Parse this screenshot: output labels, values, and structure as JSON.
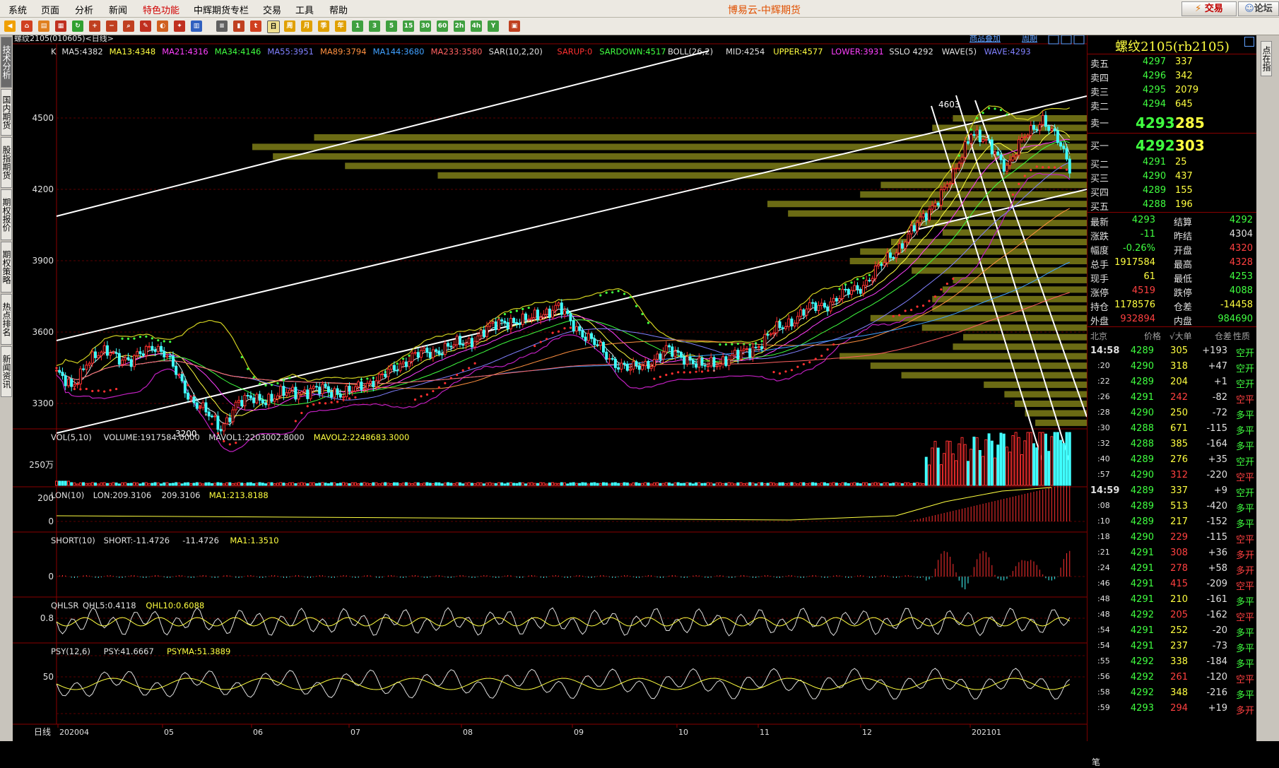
{
  "menu": {
    "items": [
      "系统",
      "页面",
      "分析",
      "新闻",
      "特色功能",
      "中辉期货专栏",
      "交易",
      "工具",
      "帮助"
    ],
    "app_title": "博易云-中辉期货",
    "trade_button": "交易",
    "forum_button": "论坛"
  },
  "left_tabs": [
    "技术分析",
    "国内期货",
    "股指期货",
    "期权报价",
    "期权策略",
    "热点排名",
    "新闻资讯"
  ],
  "right_tabs": "点在指",
  "chart": {
    "instrument_label": "螺纹2105(010605)<日线>",
    "overlay_link": "商品叠加",
    "period_link": "周期",
    "period_label": "日线",
    "main_indicators": [
      {
        "text": "K",
        "color": "#e0e0e0"
      },
      {
        "text": "MA5:4382",
        "color": "#e0e0e0"
      },
      {
        "text": "MA13:4348",
        "color": "#ffff40"
      },
      {
        "text": "MA21:4316",
        "color": "#ff40ff"
      },
      {
        "text": "MA34:4146",
        "color": "#40ff40"
      },
      {
        "text": "MA55:3951",
        "color": "#8080ff"
      },
      {
        "text": "MA89:3794",
        "color": "#ff9040"
      },
      {
        "text": "MA144:3680",
        "color": "#40a0ff"
      },
      {
        "text": "MA233:3580",
        "color": "#ff6060"
      },
      {
        "text": "SAR(10,2,20)",
        "color": "#e0e0e0"
      },
      {
        "text": "SARUP:0",
        "color": "#ff3030"
      },
      {
        "text": "SARDOWN:4517",
        "color": "#40ff40"
      },
      {
        "text": "BOLL(26,2)",
        "color": "#e0e0e0"
      },
      {
        "text": "MID:4254",
        "color": "#e0e0e0"
      },
      {
        "text": "UPPER:4577",
        "color": "#ffff40"
      },
      {
        "text": "LOWER:3931",
        "color": "#ff40ff"
      },
      {
        "text": "SSLO 4292",
        "color": "#e0e0e0"
      },
      {
        "text": "WAVE(5)",
        "color": "#e0e0e0"
      },
      {
        "text": "WAVE:4293",
        "color": "#8080ff"
      }
    ],
    "price_axis": [
      "4500",
      "4200",
      "3900",
      "3600",
      "3300"
    ],
    "annotation_high": "4603",
    "annotation_low": "3200",
    "vol_indicators": [
      {
        "text": "VOL(5,10)",
        "color": "#e0e0e0"
      },
      {
        "text": "VOLUME:1917584.0000",
        "color": "#e0e0e0"
      },
      {
        "text": "MAVOL1:2203002.8000",
        "color": "#e0e0e0"
      },
      {
        "text": "MAVOL2:2248683.3000",
        "color": "#ffff40"
      }
    ],
    "vol_axis": "250万",
    "lon_indicators": [
      {
        "text": "LON(10)",
        "color": "#e0e0e0"
      },
      {
        "text": "LON:209.3106",
        "color": "#e0e0e0"
      },
      {
        "text": "209.3106",
        "color": "#e0e0e0"
      },
      {
        "text": "MA1:213.8188",
        "color": "#ffff40"
      }
    ],
    "lon_axis": [
      "200",
      "0"
    ],
    "short_indicators": [
      {
        "text": "SHORT(10)",
        "color": "#e0e0e0"
      },
      {
        "text": "SHORT:-11.4726",
        "color": "#e0e0e0"
      },
      {
        "text": "-11.4726",
        "color": "#e0e0e0"
      },
      {
        "text": "MA1:1.3510",
        "color": "#ffff40"
      }
    ],
    "short_axis": "0",
    "qhlsr_indicators": [
      {
        "text": "QHLSR",
        "color": "#e0e0e0"
      },
      {
        "text": "QHL5:0.4118",
        "color": "#e0e0e0"
      },
      {
        "text": "QHL10:0.6088",
        "color": "#ffff40"
      }
    ],
    "qhlsr_axis": "0.8",
    "psy_indicators": [
      {
        "text": "PSY(12,6)",
        "color": "#e0e0e0"
      },
      {
        "text": "PSY:41.6667",
        "color": "#e0e0e0"
      },
      {
        "text": "PSYMA:51.3889",
        "color": "#ffff40"
      }
    ],
    "psy_axis": "50",
    "x_axis": [
      "202004",
      "05",
      "06",
      "07",
      "08",
      "09",
      "10",
      "11",
      "12",
      "202101"
    ]
  },
  "quote": {
    "title": "螺纹2105(rb2105)",
    "asks": [
      {
        "label": "卖五",
        "price": "4297",
        "vol": "337"
      },
      {
        "label": "卖四",
        "price": "4296",
        "vol": "342"
      },
      {
        "label": "卖三",
        "price": "4295",
        "vol": "2079"
      },
      {
        "label": "卖二",
        "price": "4294",
        "vol": "645"
      },
      {
        "label": "卖一",
        "price": "4293",
        "vol": "285"
      }
    ],
    "bids": [
      {
        "label": "买一",
        "price": "4292",
        "vol": "303"
      },
      {
        "label": "买二",
        "price": "4291",
        "vol": "25"
      },
      {
        "label": "买三",
        "price": "4290",
        "vol": "437"
      },
      {
        "label": "买四",
        "price": "4289",
        "vol": "155"
      },
      {
        "label": "买五",
        "price": "4288",
        "vol": "196"
      }
    ],
    "stats": [
      {
        "l1": "最新",
        "v1": "4293",
        "c1": "green",
        "l2": "结算",
        "v2": "4292",
        "c2": "green"
      },
      {
        "l1": "涨跌",
        "v1": "-11",
        "c1": "green",
        "l2": "昨结",
        "v2": "4304",
        "c2": "white"
      },
      {
        "l1": "幅度",
        "v1": "-0.26%",
        "c1": "green",
        "l2": "开盘",
        "v2": "4320",
        "c2": "red"
      },
      {
        "l1": "总手",
        "v1": "1917584",
        "c1": "yellow",
        "l2": "最高",
        "v2": "4328",
        "c2": "red"
      },
      {
        "l1": "现手",
        "v1": "61",
        "c1": "yellow",
        "l2": "最低",
        "v2": "4253",
        "c2": "green"
      },
      {
        "l1": "涨停",
        "v1": "4519",
        "c1": "red",
        "l2": "跌停",
        "v2": "4088",
        "c2": "green"
      },
      {
        "l1": "持仓",
        "v1": "1178576",
        "c1": "yellow",
        "l2": "仓差",
        "v2": "-14458",
        "c2": "yellow"
      },
      {
        "l1": "外盘",
        "v1": "932894",
        "c1": "red",
        "l2": "内盘",
        "v2": "984690",
        "c2": "green"
      }
    ],
    "tick_headers": [
      "北京",
      "价格",
      "√大单",
      "仓差",
      "性质"
    ],
    "ticks": [
      {
        "t": "14:58",
        "p": "4289",
        "v": "305",
        "d": "+193",
        "n": "空开",
        "nc": "green"
      },
      {
        "t": ":20",
        "p": "4290",
        "v": "318",
        "d": "+47",
        "n": "空开",
        "nc": "green"
      },
      {
        "t": ":22",
        "p": "4289",
        "v": "204",
        "d": "+1",
        "n": "空开",
        "nc": "green"
      },
      {
        "t": ":26",
        "p": "4291",
        "v": "242",
        "d": "-82",
        "n": "空平",
        "nc": "red"
      },
      {
        "t": ":28",
        "p": "4290",
        "v": "250",
        "d": "-72",
        "n": "多平",
        "nc": "green"
      },
      {
        "t": ":30",
        "p": "4288",
        "v": "671",
        "d": "-115",
        "n": "多平",
        "nc": "green"
      },
      {
        "t": ":32",
        "p": "4288",
        "v": "385",
        "d": "-164",
        "n": "多平",
        "nc": "green"
      },
      {
        "t": ":40",
        "p": "4289",
        "v": "276",
        "d": "+35",
        "n": "空开",
        "nc": "green"
      },
      {
        "t": ":57",
        "p": "4290",
        "v": "312",
        "d": "-220",
        "n": "空平",
        "nc": "red"
      },
      {
        "t": "14:59",
        "p": "4289",
        "v": "337",
        "d": "+9",
        "n": "空开",
        "nc": "green"
      },
      {
        "t": ":08",
        "p": "4289",
        "v": "513",
        "d": "-420",
        "n": "多平",
        "nc": "green"
      },
      {
        "t": ":10",
        "p": "4289",
        "v": "217",
        "d": "-152",
        "n": "多平",
        "nc": "green"
      },
      {
        "t": ":18",
        "p": "4290",
        "v": "229",
        "d": "-115",
        "n": "空平",
        "nc": "red"
      },
      {
        "t": ":21",
        "p": "4291",
        "v": "308",
        "d": "+36",
        "n": "多开",
        "nc": "red"
      },
      {
        "t": ":24",
        "p": "4291",
        "v": "278",
        "d": "+58",
        "n": "多开",
        "nc": "red"
      },
      {
        "t": ":46",
        "p": "4291",
        "v": "415",
        "d": "-209",
        "n": "空平",
        "nc": "red"
      },
      {
        "t": ":48",
        "p": "4291",
        "v": "210",
        "d": "-161",
        "n": "多平",
        "nc": "green"
      },
      {
        "t": ":48",
        "p": "4292",
        "v": "205",
        "d": "-162",
        "n": "空平",
        "nc": "red"
      },
      {
        "t": ":54",
        "p": "4291",
        "v": "252",
        "d": "-20",
        "n": "多平",
        "nc": "green"
      },
      {
        "t": ":54",
        "p": "4291",
        "v": "237",
        "d": "-73",
        "n": "多平",
        "nc": "green"
      },
      {
        "t": ":55",
        "p": "4292",
        "v": "338",
        "d": "-184",
        "n": "多平",
        "nc": "green"
      },
      {
        "t": ":56",
        "p": "4292",
        "v": "261",
        "d": "-120",
        "n": "空平",
        "nc": "red"
      },
      {
        "t": ":58",
        "p": "4292",
        "v": "348",
        "d": "-216",
        "n": "多平",
        "nc": "green"
      },
      {
        "t": ":59",
        "p": "4293",
        "v": "294",
        "d": "+19",
        "n": "多开",
        "nc": "red"
      }
    ],
    "footer": "笔"
  },
  "chart_data": {
    "type": "candlestick",
    "title": "螺纹2105(010605)<日线>",
    "x_labels": [
      "202004",
      "05",
      "06",
      "07",
      "08",
      "09",
      "10",
      "11",
      "12",
      "202101"
    ],
    "ylim": [
      3150,
      4650
    ],
    "y_ticks": [
      3300,
      3600,
      3900,
      4200,
      4500
    ],
    "close_path": [
      [
        0,
        3430
      ],
      [
        5,
        3360
      ],
      [
        10,
        3480
      ],
      [
        18,
        3520
      ],
      [
        25,
        3470
      ],
      [
        32,
        3550
      ],
      [
        36,
        3510
      ],
      [
        40,
        3430
      ],
      [
        45,
        3320
      ],
      [
        50,
        3260
      ],
      [
        55,
        3200
      ],
      [
        60,
        3290
      ],
      [
        66,
        3330
      ],
      [
        72,
        3310
      ],
      [
        78,
        3360
      ],
      [
        84,
        3340
      ],
      [
        90,
        3370
      ],
      [
        96,
        3330
      ],
      [
        102,
        3380
      ],
      [
        108,
        3400
      ],
      [
        114,
        3460
      ],
      [
        120,
        3500
      ],
      [
        126,
        3520
      ],
      [
        132,
        3540
      ],
      [
        138,
        3560
      ],
      [
        144,
        3610
      ],
      [
        150,
        3650
      ],
      [
        156,
        3640
      ],
      [
        162,
        3680
      ],
      [
        168,
        3700
      ],
      [
        174,
        3620
      ],
      [
        180,
        3550
      ],
      [
        186,
        3480
      ],
      [
        192,
        3440
      ],
      [
        198,
        3470
      ],
      [
        204,
        3520
      ],
      [
        210,
        3500
      ],
      [
        216,
        3450
      ],
      [
        222,
        3480
      ],
      [
        228,
        3500
      ],
      [
        234,
        3540
      ],
      [
        240,
        3600
      ],
      [
        246,
        3650
      ],
      [
        252,
        3700
      ],
      [
        258,
        3720
      ],
      [
        264,
        3760
      ],
      [
        270,
        3800
      ],
      [
        276,
        3880
      ],
      [
        282,
        3960
      ],
      [
        288,
        4050
      ],
      [
        294,
        4150
      ],
      [
        300,
        4250
      ],
      [
        306,
        4450
      ],
      [
        312,
        4380
      ],
      [
        318,
        4300
      ],
      [
        324,
        4420
      ],
      [
        330,
        4500
      ],
      [
        336,
        4380
      ],
      [
        339,
        4293
      ]
    ],
    "volume_profile_price_levels": [
      4500,
      4460,
      4420,
      4380,
      4340,
      4300,
      4260,
      4220,
      4180,
      4140,
      4100,
      4060,
      4020,
      3980,
      3940,
      3900,
      3860,
      3820,
      3780,
      3740,
      3700,
      3660,
      3620,
      3580,
      3540,
      3500,
      3460,
      3420,
      3380,
      3340,
      3300,
      3260,
      3220
    ],
    "volume_profile_widths": [
      0.13,
      0.15,
      0.75,
      0.81,
      0.79,
      0.72,
      0.63,
      0.2,
      0.22,
      0.31,
      0.29,
      0.17,
      0.14,
      0.19,
      0.22,
      0.23,
      0.17,
      0.13,
      0.14,
      0.15,
      0.15,
      0.21,
      0.16,
      0.12,
      0.13,
      0.24,
      0.21,
      0.18,
      0.1,
      0.08,
      0.07,
      0.06,
      0.05
    ],
    "volume": {
      "name": "VOLUME",
      "last": 1917584,
      "unit_label": "250万"
    },
    "bands": {
      "upper": 4577,
      "mid": 4254,
      "lower": 3931
    }
  }
}
